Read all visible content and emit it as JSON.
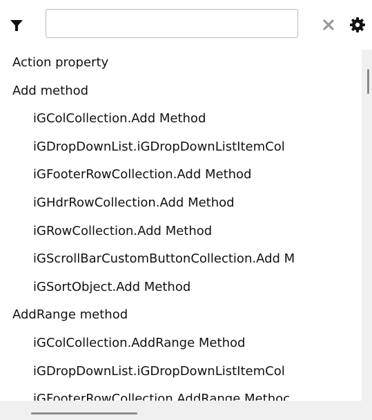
{
  "toolbar": {
    "filter_icon": "filter-icon",
    "search": {
      "value": "",
      "placeholder": ""
    },
    "clear_icon": "close-icon",
    "settings_icon": "gear-icon"
  },
  "list": {
    "items": [
      {
        "label": "Action property",
        "level": 0
      },
      {
        "label": "Add method",
        "level": 0
      },
      {
        "label": "iGColCollection.Add Method",
        "level": 1
      },
      {
        "label": "iGDropDownList.iGDropDownListItemCol",
        "level": 1
      },
      {
        "label": "iGFooterRowCollection.Add Method",
        "level": 1
      },
      {
        "label": "iGHdrRowCollection.Add Method",
        "level": 1
      },
      {
        "label": "iGRowCollection.Add Method",
        "level": 1
      },
      {
        "label": "iGScrollBarCustomButtonCollection.Add M",
        "level": 1
      },
      {
        "label": "iGSortObject.Add Method",
        "level": 1
      },
      {
        "label": "AddRange method",
        "level": 0
      },
      {
        "label": "iGColCollection.AddRange Method",
        "level": 1
      },
      {
        "label": "iGDropDownList.iGDropDownListItemCol",
        "level": 1
      },
      {
        "label": "iGFooterRowCollection.AddRange Methoc",
        "level": 1
      }
    ]
  },
  "colors": {
    "scrollbar_track": "#f0f0f0",
    "scrollbar_thumb": "#8a8a8a",
    "input_border": "#b9b9b9",
    "icon_gray": "#9a9a9a",
    "icon_dark": "#111111"
  }
}
